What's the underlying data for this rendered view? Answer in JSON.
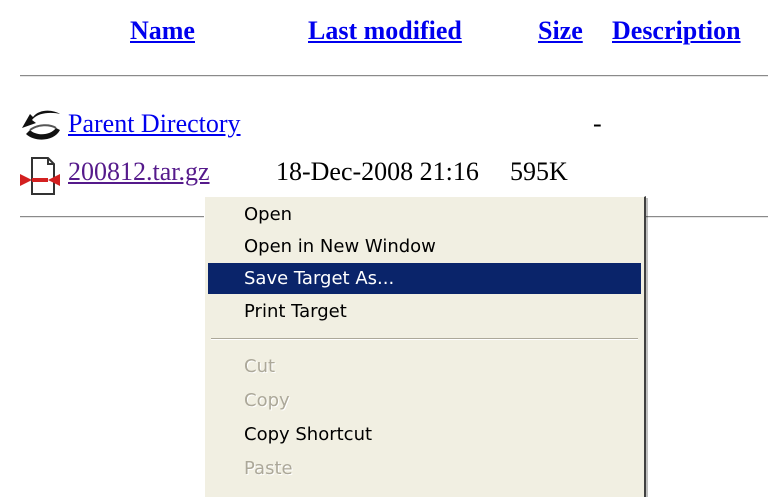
{
  "listing": {
    "headers": {
      "name": "Name",
      "last_modified": "Last modified",
      "size": "Size",
      "description": "Description"
    },
    "rows": [
      {
        "name": "Parent Directory",
        "last_modified": "",
        "size": "-",
        "icon": "back-icon"
      },
      {
        "name": "200812.tar.gz",
        "last_modified": "18-Dec-2008 21:16",
        "size": "595K",
        "icon": "compressed-file-icon"
      }
    ]
  },
  "context_menu": {
    "items": [
      {
        "label": "Open",
        "state": "normal"
      },
      {
        "label": "Open in New Window",
        "state": "normal"
      },
      {
        "label": "Save Target As...",
        "state": "selected"
      },
      {
        "label": "Print Target",
        "state": "normal"
      },
      {
        "label": "Cut",
        "state": "disabled"
      },
      {
        "label": "Copy",
        "state": "disabled"
      },
      {
        "label": "Copy Shortcut",
        "state": "normal"
      },
      {
        "label": "Paste",
        "state": "disabled"
      }
    ]
  },
  "colors": {
    "link": "#0000ee",
    "visited_link": "#551a8b",
    "menu_bg": "#f1efe2",
    "menu_highlight": "#0a246a",
    "disabled_text": "#aca899"
  }
}
